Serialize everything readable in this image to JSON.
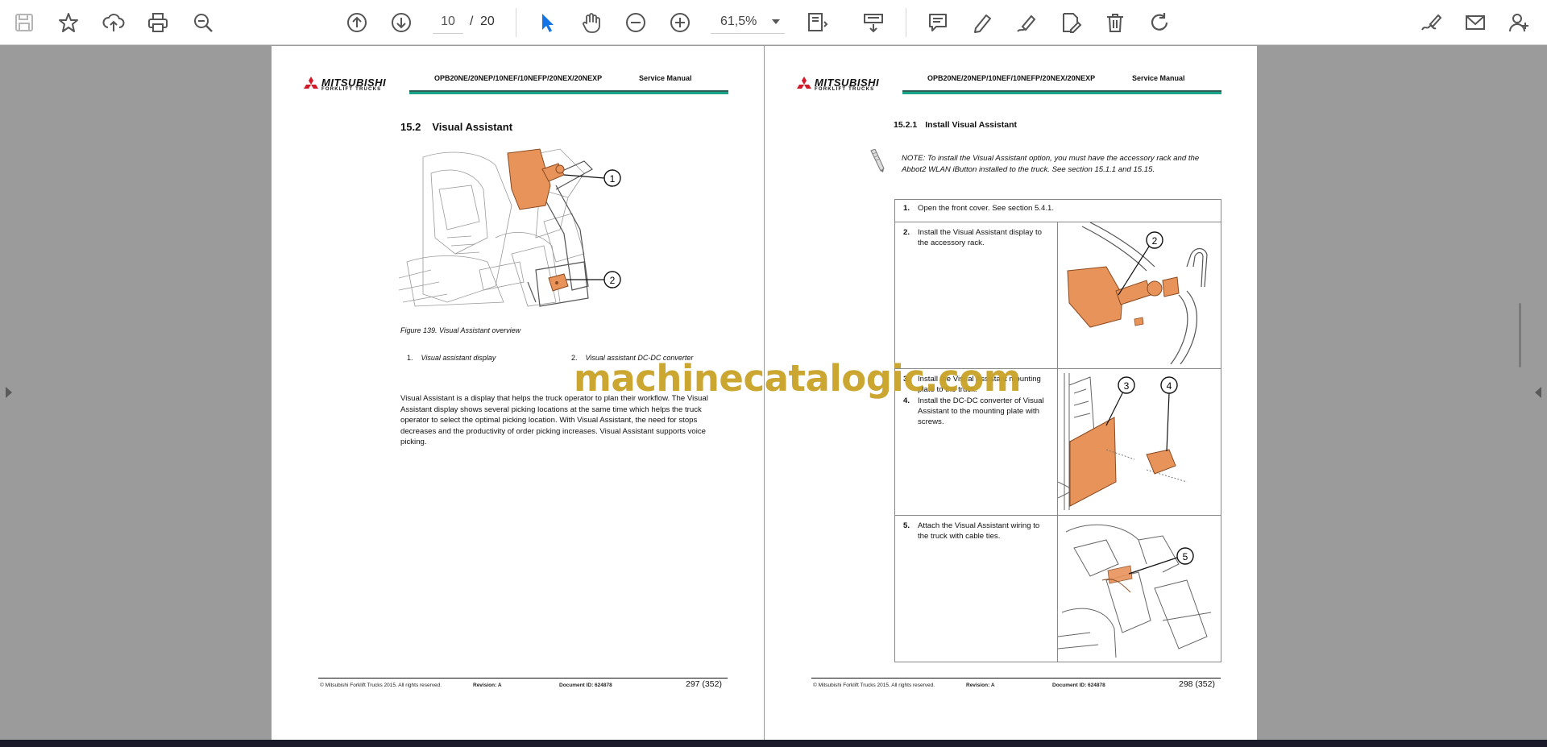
{
  "toolbar": {
    "page": {
      "current": "10",
      "separator": "/",
      "total": "20"
    },
    "zoom": "61,5%",
    "icons": [
      "save-icon",
      "bookmark-star-icon",
      "upload-cloud-icon",
      "print-icon",
      "zoom-search-icon",
      "page-up-icon",
      "page-down-icon",
      "select-cursor-icon",
      "hand-tool-icon",
      "zoom-out-icon",
      "zoom-in-icon",
      "fit-page-icon",
      "scroll-mode-icon",
      "comment-icon",
      "highlight-pen-icon",
      "draw-icon",
      "edit-pdf-icon",
      "delete-icon",
      "rotate-icon",
      "sign-icon",
      "email-icon",
      "share-user-icon"
    ]
  },
  "pages": {
    "header": {
      "brand": "MITSUBISHI",
      "brand_sub": "FORKLIFT TRUCKS",
      "model": "OPB20NE/20NEP/10NEF/10NEFP/20NEX/20NEXP",
      "doc_type": "Service Manual",
      "colors": {
        "line_dark": "#2a5f55",
        "line_green": "#1aa58a",
        "logo_red": "#d11a2a"
      }
    },
    "footer": {
      "copyright": "© Mitsubishi Forklift Trucks 2015. All rights reserved.",
      "revision": "Revision: A",
      "document_id": "Document ID: 624878"
    },
    "left": {
      "section_number": "15.2",
      "section_title": "Visual Assistant",
      "figure_caption": "Figure 139. Visual Assistant overview",
      "callouts": [
        "1",
        "2"
      ],
      "legend": [
        {
          "number": "1.",
          "text": "Visual assistant display"
        },
        {
          "number": "2.",
          "text": "Visual assistant DC-DC converter"
        }
      ],
      "body": "Visual Assistant is a display that helps the truck operator to plan their workflow. The Visual Assistant display shows several picking locations at the same time which helps the truck operator to select the optimal picking location. With Visual Assistant, the need for stops decreases and the productivity of order picking increases. Visual Assistant supports voice picking.",
      "page_number": "297 (352)"
    },
    "right": {
      "section_number": "15.2.1",
      "section_title": "Install Visual Assistant",
      "note": "NOTE: To install the Visual Assistant option, you must have the accessory rack and the Abbot2 WLAN iButton installed to the truck. See section 15.1.1  and 15.15.",
      "steps": [
        {
          "number": "1.",
          "text": "Open the front cover. See section 5.4.1."
        },
        {
          "number": "2.",
          "text": "Install the Visual Assistant display to the accessory rack."
        },
        {
          "number": "3.",
          "text": "Install the Visual Assistant mounting plate to the truck."
        },
        {
          "number": "4.",
          "text": "Install the DC-DC converter of Visual Assistant to the mounting plate with screws."
        },
        {
          "number": "5.",
          "text": "Attach the Visual Assistant wiring to the truck with cable ties."
        }
      ],
      "callouts": {
        "step2": "2",
        "step3": "3",
        "step4": "4",
        "step5": "5"
      },
      "page_number": "298 (352)"
    }
  },
  "watermark": "machinecatalogic.com",
  "colors": {
    "part_orange": "#e8935a",
    "watermark": "#c9a227",
    "viewer_bg": "#9b9b9b"
  }
}
